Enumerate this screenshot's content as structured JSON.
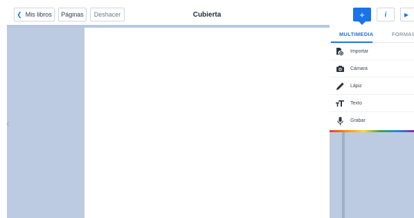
{
  "toolbar": {
    "back_label": "Mis libros",
    "pages_label": "Páginas",
    "undo_label": "Deshacer",
    "title": "Cubierta",
    "add_glyph": "+",
    "info_glyph": "i",
    "play_glyph": "▶"
  },
  "panel": {
    "tabs": [
      {
        "label": "MULTIMEDIA",
        "active": true
      },
      {
        "label": "FORMAS",
        "active": false
      }
    ],
    "items": [
      {
        "label": "Importar",
        "icon": "import-file-icon"
      },
      {
        "label": "Cámara",
        "icon": "camera-icon"
      },
      {
        "label": "Lápiz",
        "icon": "pencil-icon"
      },
      {
        "label": "Texto",
        "icon": "text-icon"
      },
      {
        "label": "Grabar",
        "icon": "microphone-icon"
      }
    ]
  },
  "colors": {
    "accent": "#1a73e8",
    "background": "#bccbe1",
    "canvas": "#ffffff"
  }
}
